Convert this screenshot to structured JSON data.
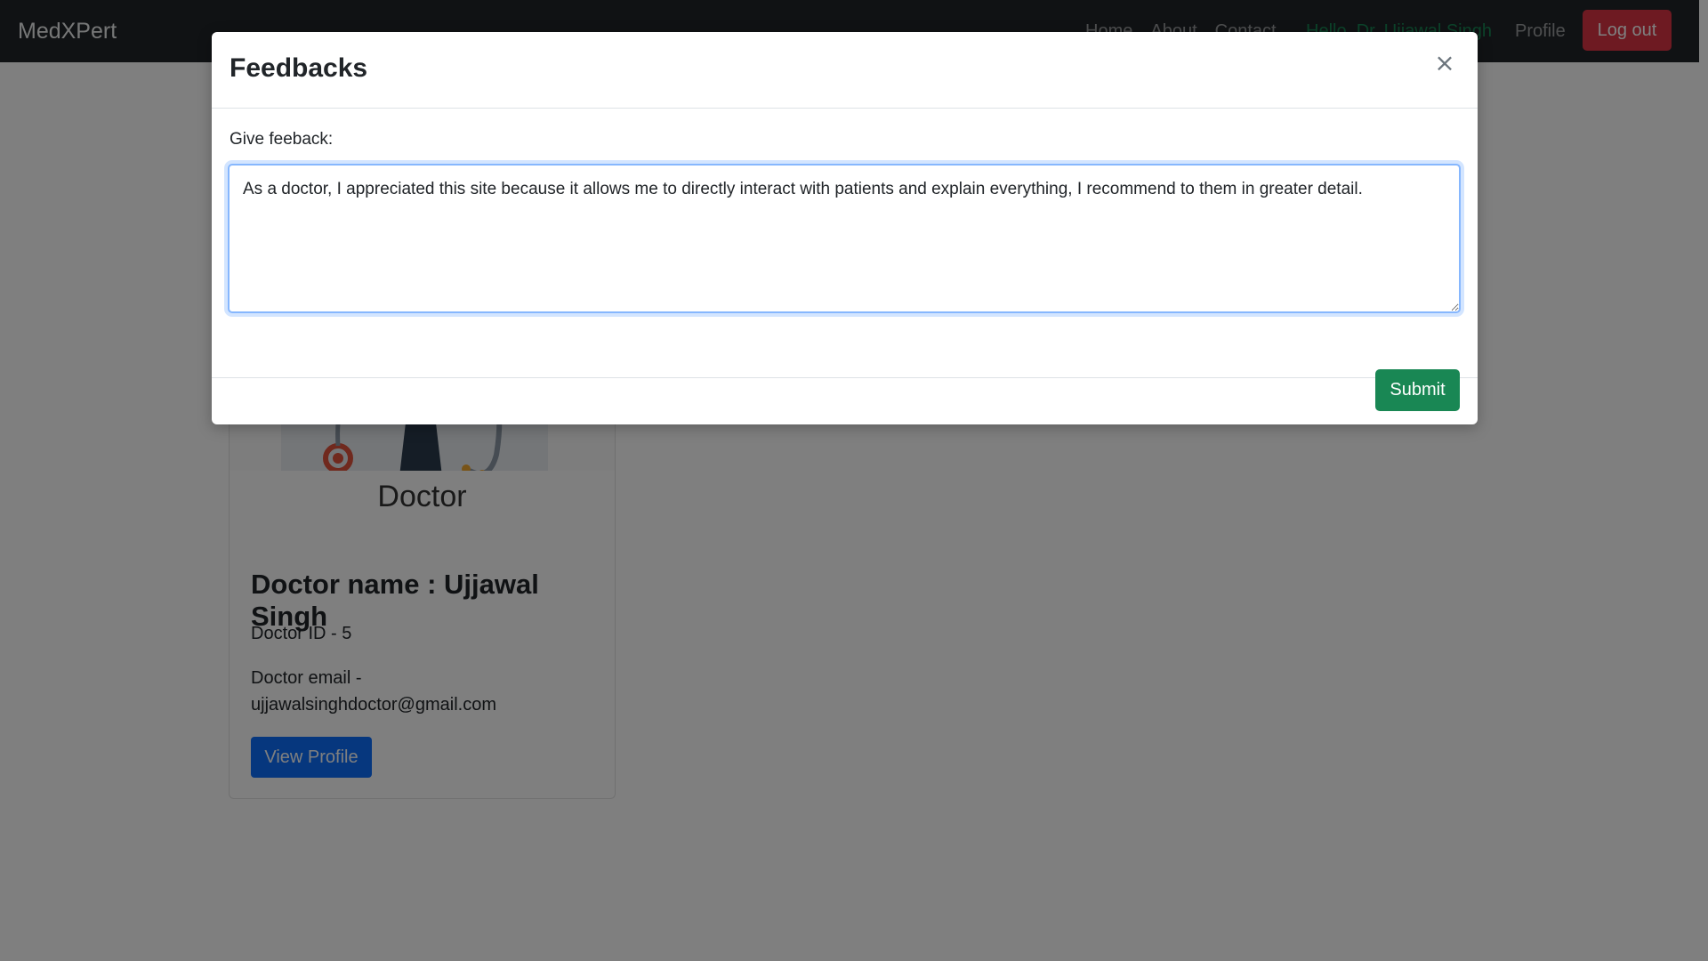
{
  "navbar": {
    "brand": "MedXPert",
    "links": [
      "Home",
      "About",
      "Contact"
    ],
    "greeting": "Hello, Dr. Ujjawal Singh",
    "profile": "Profile",
    "logout": "Log out",
    "greeting_color": "#198754"
  },
  "card": {
    "image_caption": "Doctor",
    "title": "Doctor name : Ujjawal Singh",
    "id_text": "Doctor ID - 5",
    "email_label": "Doctor email -",
    "email": "ujjawalsinghdoctor@gmail.com",
    "view_profile": "View Profile"
  },
  "modal": {
    "title": "Feedbacks",
    "close_glyph": "×",
    "label": "Give feeback:",
    "textarea_value": "As a doctor, I appreciated this site because it allows me to directly interact with patients and explain everything, I recommend to them in greater detail.",
    "submit": "Submit"
  },
  "colors": {
    "submit": "#198754",
    "logout": "#dc3545",
    "view_profile": "#0d6efd",
    "focus_border": "#86b7fe"
  }
}
